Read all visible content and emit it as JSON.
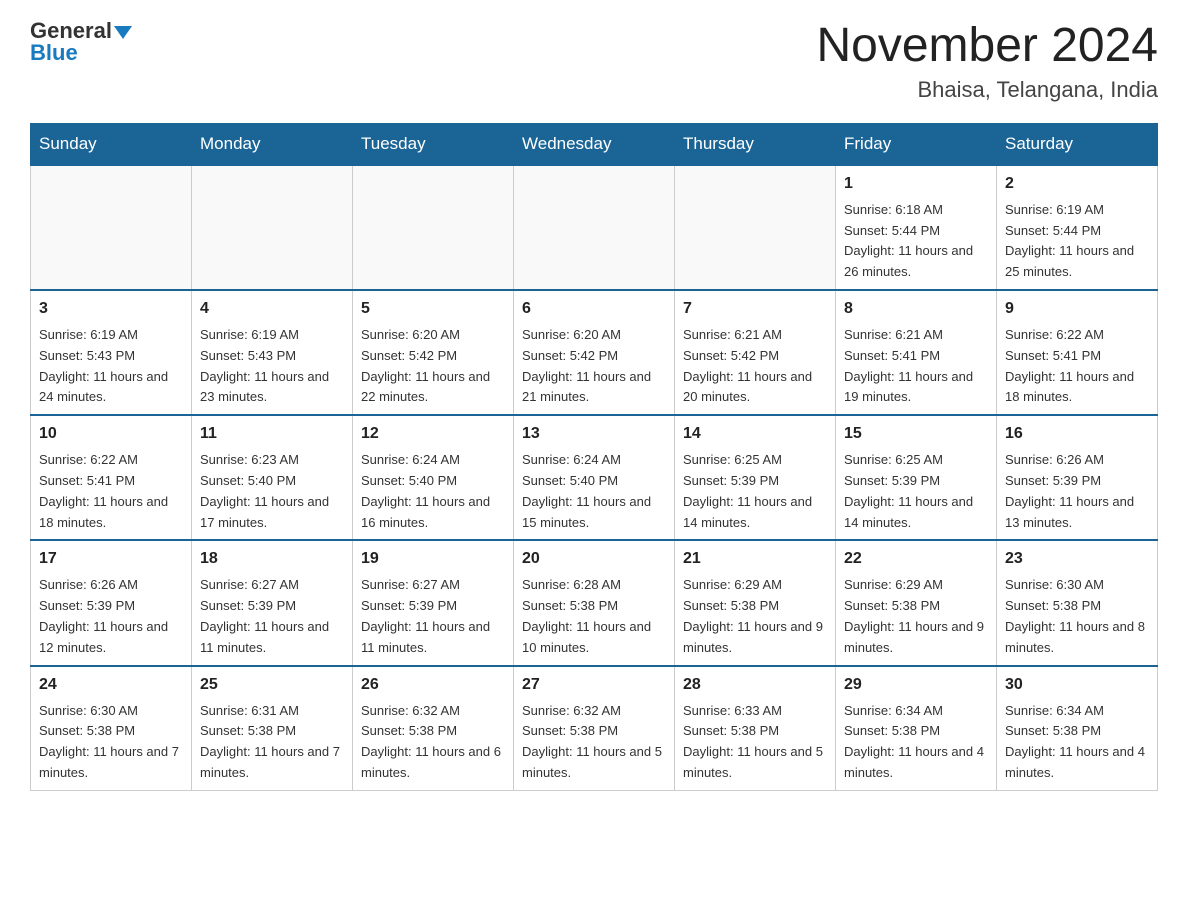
{
  "header": {
    "logo_general": "General",
    "logo_blue": "Blue",
    "month_title": "November 2024",
    "location": "Bhaisa, Telangana, India"
  },
  "days_of_week": [
    "Sunday",
    "Monday",
    "Tuesday",
    "Wednesday",
    "Thursday",
    "Friday",
    "Saturday"
  ],
  "weeks": [
    [
      {
        "day": "",
        "info": ""
      },
      {
        "day": "",
        "info": ""
      },
      {
        "day": "",
        "info": ""
      },
      {
        "day": "",
        "info": ""
      },
      {
        "day": "",
        "info": ""
      },
      {
        "day": "1",
        "info": "Sunrise: 6:18 AM\nSunset: 5:44 PM\nDaylight: 11 hours and 26 minutes."
      },
      {
        "day": "2",
        "info": "Sunrise: 6:19 AM\nSunset: 5:44 PM\nDaylight: 11 hours and 25 minutes."
      }
    ],
    [
      {
        "day": "3",
        "info": "Sunrise: 6:19 AM\nSunset: 5:43 PM\nDaylight: 11 hours and 24 minutes."
      },
      {
        "day": "4",
        "info": "Sunrise: 6:19 AM\nSunset: 5:43 PM\nDaylight: 11 hours and 23 minutes."
      },
      {
        "day": "5",
        "info": "Sunrise: 6:20 AM\nSunset: 5:42 PM\nDaylight: 11 hours and 22 minutes."
      },
      {
        "day": "6",
        "info": "Sunrise: 6:20 AM\nSunset: 5:42 PM\nDaylight: 11 hours and 21 minutes."
      },
      {
        "day": "7",
        "info": "Sunrise: 6:21 AM\nSunset: 5:42 PM\nDaylight: 11 hours and 20 minutes."
      },
      {
        "day": "8",
        "info": "Sunrise: 6:21 AM\nSunset: 5:41 PM\nDaylight: 11 hours and 19 minutes."
      },
      {
        "day": "9",
        "info": "Sunrise: 6:22 AM\nSunset: 5:41 PM\nDaylight: 11 hours and 18 minutes."
      }
    ],
    [
      {
        "day": "10",
        "info": "Sunrise: 6:22 AM\nSunset: 5:41 PM\nDaylight: 11 hours and 18 minutes."
      },
      {
        "day": "11",
        "info": "Sunrise: 6:23 AM\nSunset: 5:40 PM\nDaylight: 11 hours and 17 minutes."
      },
      {
        "day": "12",
        "info": "Sunrise: 6:24 AM\nSunset: 5:40 PM\nDaylight: 11 hours and 16 minutes."
      },
      {
        "day": "13",
        "info": "Sunrise: 6:24 AM\nSunset: 5:40 PM\nDaylight: 11 hours and 15 minutes."
      },
      {
        "day": "14",
        "info": "Sunrise: 6:25 AM\nSunset: 5:39 PM\nDaylight: 11 hours and 14 minutes."
      },
      {
        "day": "15",
        "info": "Sunrise: 6:25 AM\nSunset: 5:39 PM\nDaylight: 11 hours and 14 minutes."
      },
      {
        "day": "16",
        "info": "Sunrise: 6:26 AM\nSunset: 5:39 PM\nDaylight: 11 hours and 13 minutes."
      }
    ],
    [
      {
        "day": "17",
        "info": "Sunrise: 6:26 AM\nSunset: 5:39 PM\nDaylight: 11 hours and 12 minutes."
      },
      {
        "day": "18",
        "info": "Sunrise: 6:27 AM\nSunset: 5:39 PM\nDaylight: 11 hours and 11 minutes."
      },
      {
        "day": "19",
        "info": "Sunrise: 6:27 AM\nSunset: 5:39 PM\nDaylight: 11 hours and 11 minutes."
      },
      {
        "day": "20",
        "info": "Sunrise: 6:28 AM\nSunset: 5:38 PM\nDaylight: 11 hours and 10 minutes."
      },
      {
        "day": "21",
        "info": "Sunrise: 6:29 AM\nSunset: 5:38 PM\nDaylight: 11 hours and 9 minutes."
      },
      {
        "day": "22",
        "info": "Sunrise: 6:29 AM\nSunset: 5:38 PM\nDaylight: 11 hours and 9 minutes."
      },
      {
        "day": "23",
        "info": "Sunrise: 6:30 AM\nSunset: 5:38 PM\nDaylight: 11 hours and 8 minutes."
      }
    ],
    [
      {
        "day": "24",
        "info": "Sunrise: 6:30 AM\nSunset: 5:38 PM\nDaylight: 11 hours and 7 minutes."
      },
      {
        "day": "25",
        "info": "Sunrise: 6:31 AM\nSunset: 5:38 PM\nDaylight: 11 hours and 7 minutes."
      },
      {
        "day": "26",
        "info": "Sunrise: 6:32 AM\nSunset: 5:38 PM\nDaylight: 11 hours and 6 minutes."
      },
      {
        "day": "27",
        "info": "Sunrise: 6:32 AM\nSunset: 5:38 PM\nDaylight: 11 hours and 5 minutes."
      },
      {
        "day": "28",
        "info": "Sunrise: 6:33 AM\nSunset: 5:38 PM\nDaylight: 11 hours and 5 minutes."
      },
      {
        "day": "29",
        "info": "Sunrise: 6:34 AM\nSunset: 5:38 PM\nDaylight: 11 hours and 4 minutes."
      },
      {
        "day": "30",
        "info": "Sunrise: 6:34 AM\nSunset: 5:38 PM\nDaylight: 11 hours and 4 minutes."
      }
    ]
  ]
}
